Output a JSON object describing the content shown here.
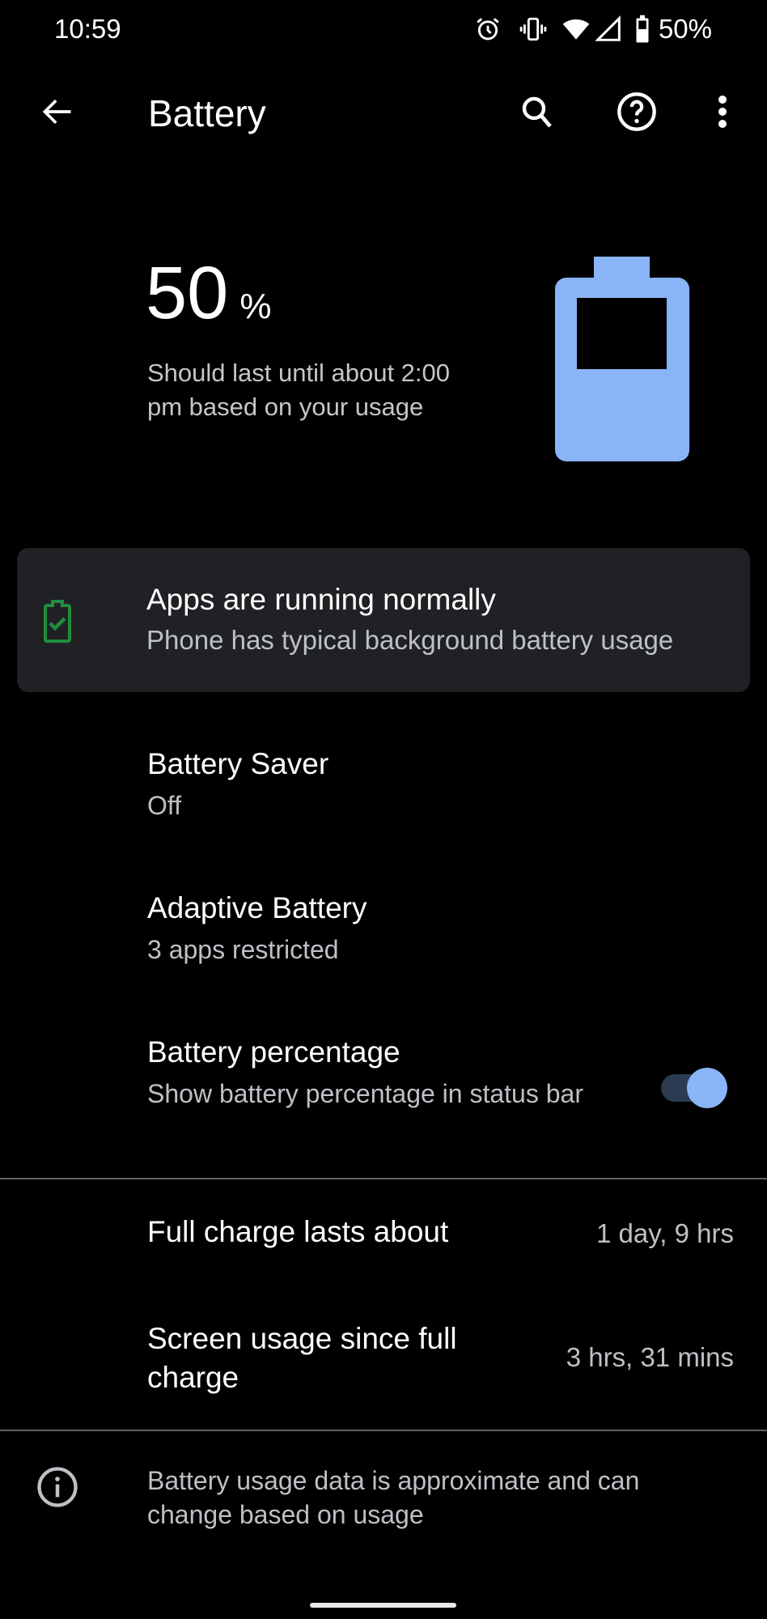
{
  "status_bar": {
    "time": "10:59",
    "battery_percent": "50%",
    "icons": [
      "alarm-icon",
      "vibrate-icon",
      "wifi-icon",
      "cell-signal-icon",
      "battery-icon"
    ]
  },
  "app_bar": {
    "title": "Battery",
    "back_icon": "arrow-back-icon",
    "actions": [
      "search-icon",
      "help-icon",
      "more-vert-icon"
    ]
  },
  "battery_header": {
    "level_value": "50",
    "level_unit": "%",
    "level_fraction": 0.5,
    "estimate": "Should last until about 2:00 pm based on your usage",
    "accent_color": "#8ab4f8"
  },
  "tip_card": {
    "icon": "battery-check-icon",
    "icon_color": "#1e8e3e",
    "title": "Apps are running normally",
    "subtitle": "Phone has typical background battery usage"
  },
  "preferences": [
    {
      "title": "Battery Saver",
      "summary": "Off"
    },
    {
      "title": "Adaptive Battery",
      "summary": "3 apps restricted"
    },
    {
      "title": "Battery percentage",
      "summary": "Show battery percentage in status bar",
      "toggle_on": true
    }
  ],
  "stats": [
    {
      "label": "Full charge lasts about",
      "value": "1 day, 9 hrs"
    },
    {
      "label": "Screen usage since full charge",
      "value": "3 hrs, 31 mins"
    }
  ],
  "footer": {
    "icon": "info-icon",
    "text": "Battery usage data is approximate and can change based on usage"
  }
}
